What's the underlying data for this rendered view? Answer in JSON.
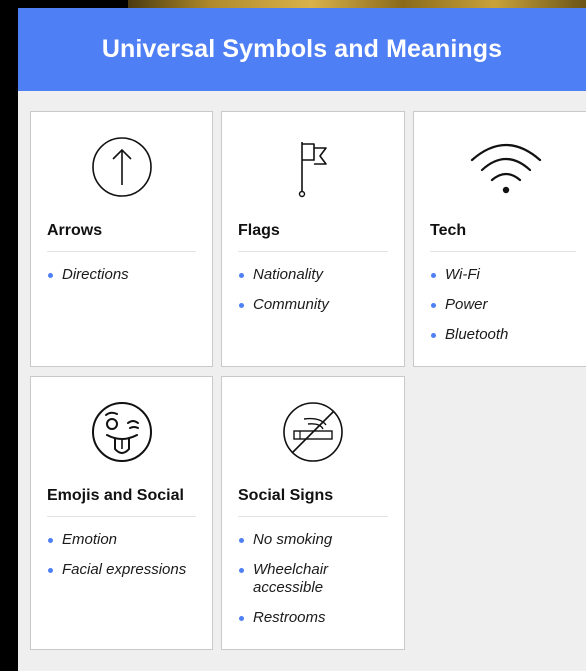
{
  "header": {
    "title": "Universal Symbols and Meanings"
  },
  "colors": {
    "accent": "#4f7ff5",
    "card_background": "#ffffff",
    "panel_background": "#efefef"
  },
  "cards": [
    {
      "title": "Arrows",
      "icon": "arrow-up-circle-icon",
      "items": [
        "Directions"
      ]
    },
    {
      "title": "Flags",
      "icon": "flag-icon",
      "items": [
        "Nationality",
        "Community"
      ]
    },
    {
      "title": "Tech",
      "icon": "wifi-icon",
      "items": [
        "Wi-Fi",
        "Power",
        "Bluetooth"
      ]
    },
    {
      "title": "Emojis and Social",
      "icon": "winking-tongue-emoji-icon",
      "items": [
        "Emotion",
        "Facial expressions"
      ]
    },
    {
      "title": "Social Signs",
      "icon": "no-smoking-icon",
      "items": [
        "No smoking",
        "Wheelchair accessible",
        "Restrooms"
      ]
    }
  ]
}
